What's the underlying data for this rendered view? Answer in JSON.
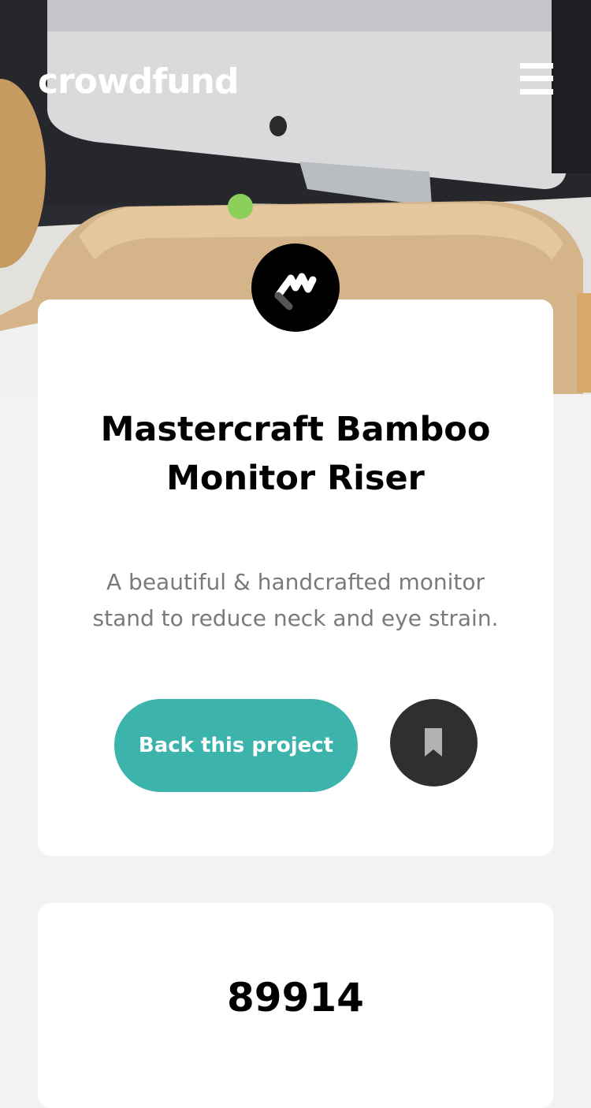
{
  "header": {
    "brand": "crowdfund",
    "menu_icon": "hamburger-icon"
  },
  "project": {
    "logo_icon": "mastercraft-logo-icon",
    "title_line1": "Mastercraft Bamboo",
    "title_line2": "Monitor Riser",
    "description": "A beautiful & handcrafted monitor stand to reduce neck and eye strain.",
    "back_button_label": "Back this project",
    "bookmark_icon": "bookmark-icon"
  },
  "stats": {
    "amount_backed": "89914"
  },
  "colors": {
    "accent": "#3cb3ab",
    "dark": "#2f2f2f",
    "page_bg": "#f2f2f2",
    "text_muted": "#7a7a7a"
  }
}
